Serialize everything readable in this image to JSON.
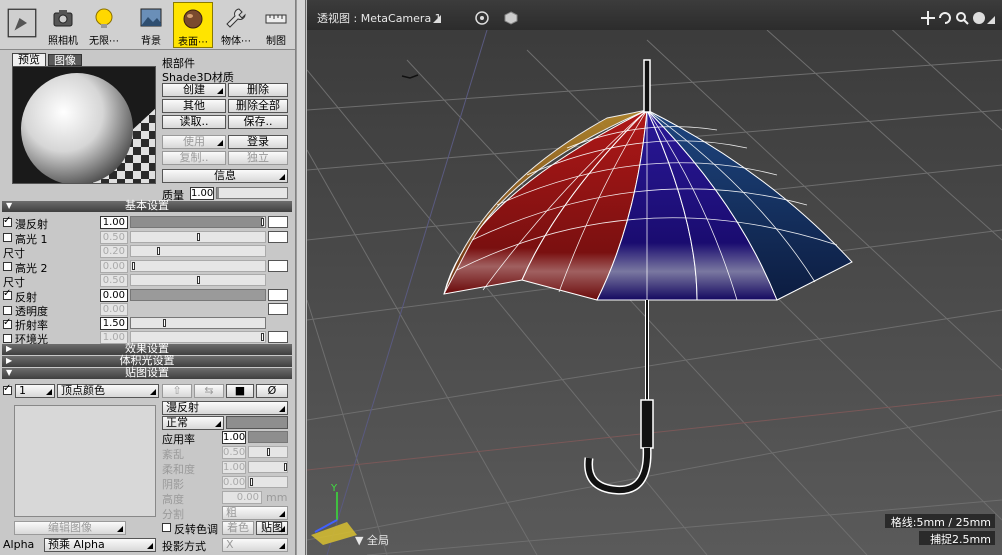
{
  "toolbar": {
    "items": [
      {
        "label": ""
      },
      {
        "label": "照相机"
      },
      {
        "label": "无限⋯"
      },
      {
        "label": "背景"
      },
      {
        "label": "表面⋯"
      },
      {
        "label": "物体⋯"
      },
      {
        "label": "制图"
      }
    ]
  },
  "tabs": {
    "preview": "预览",
    "image": "图像"
  },
  "material": {
    "root": "根部件",
    "name": "Shade3D材质",
    "buttons": {
      "create": "创建",
      "delete": "删除",
      "other": "其他",
      "delete_all": "删除全部",
      "read": "读取..",
      "save": "保存..",
      "use": "使用",
      "register": "登录",
      "copy": "复制..",
      "independent": "独立",
      "info": "信息"
    },
    "quality_label": "质量",
    "quality_value": "1.00"
  },
  "sections": {
    "basic": "基本设置",
    "effects": "效果设置",
    "volume": "体积光设置",
    "mapping": "贴图设置"
  },
  "basic": {
    "diffuse": {
      "label": "漫反射",
      "value": "1.00",
      "checked": true
    },
    "highlight1": {
      "label": "高光 1",
      "value": "0.50",
      "checked": false
    },
    "size1": {
      "label": "尺寸",
      "value": "0.20"
    },
    "highlight2": {
      "label": "高光 2",
      "value": "0.00",
      "checked": false
    },
    "size2": {
      "label": "尺寸",
      "value": "0.50"
    },
    "reflection": {
      "label": "反射",
      "value": "0.00",
      "checked": true
    },
    "transparency": {
      "label": "透明度",
      "value": "0.00",
      "checked": false
    },
    "refraction": {
      "label": "折射率",
      "value": "1.50",
      "checked": true
    },
    "ambient": {
      "label": "环境光",
      "value": "1.00",
      "checked": false
    }
  },
  "mapping": {
    "layer_index": "1",
    "layer_type": "顶点颜色",
    "attribute": "漫反射",
    "mode": "正常",
    "apply_label": "应用率",
    "apply_value": "1.00",
    "random_label": "紊乱",
    "random_value": "0.50",
    "softness_label": "柔和度",
    "softness_value": "1.00",
    "shadow_label": "阴影",
    "shadow_value": "0.00",
    "height_label": "高度",
    "height_value": "0.00",
    "height_unit": "mm",
    "division_label": "分割",
    "division_value": "粗",
    "edit_image": "编辑图像",
    "invert_label": "反转色调",
    "coloring": "着色",
    "map_btn": "贴图",
    "alpha_label": "Alpha",
    "alpha_value": "预乘 Alpha",
    "projection_label": "投影方式",
    "projection_value": "X"
  },
  "viewport": {
    "title": "透视图 : MetaCamera 1",
    "grid_label": "格线:5mm / 25mm",
    "snap_label": "捕捉2.5mm",
    "global_label": "全局",
    "axis_y": "Y"
  },
  "colors": {
    "accent_yellow": "#ffe400",
    "panel_bg": "#c8c8c8",
    "viewport_bg": "#4a4a4a"
  }
}
